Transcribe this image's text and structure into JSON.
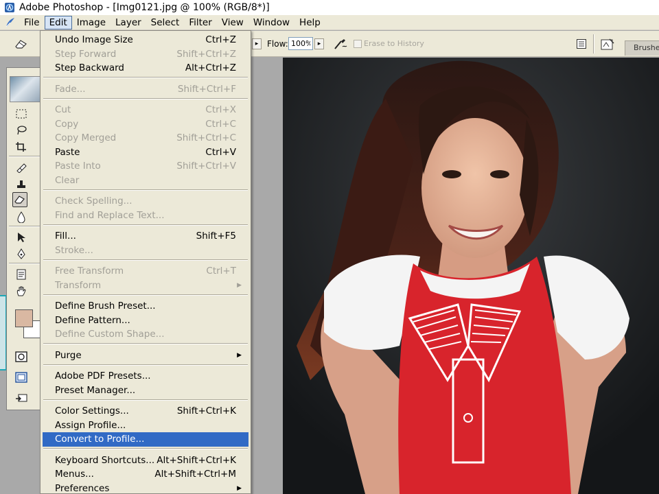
{
  "window": {
    "title": "Adobe Photoshop - [Img0121.jpg @ 100% (RGB/8*)]"
  },
  "menubar": {
    "items": [
      "File",
      "Edit",
      "Image",
      "Layer",
      "Select",
      "Filter",
      "View",
      "Window",
      "Help"
    ],
    "active": "Edit"
  },
  "options": {
    "flow_label": "Flow:",
    "flow_value": "100%",
    "erase_history_label": "Erase to History",
    "brushes_tab": "Brushes"
  },
  "edit_menu": {
    "items": [
      {
        "label": "Undo Image Size",
        "shortcut": "Ctrl+Z",
        "enabled": true
      },
      {
        "label": "Step Forward",
        "shortcut": "Shift+Ctrl+Z",
        "enabled": false
      },
      {
        "label": "Step Backward",
        "shortcut": "Alt+Ctrl+Z",
        "enabled": true
      },
      {
        "label": "Fade...",
        "shortcut": "Shift+Ctrl+F",
        "enabled": false
      },
      {
        "label": "Cut",
        "shortcut": "Ctrl+X",
        "enabled": false
      },
      {
        "label": "Copy",
        "shortcut": "Ctrl+C",
        "enabled": false
      },
      {
        "label": "Copy Merged",
        "shortcut": "Shift+Ctrl+C",
        "enabled": false
      },
      {
        "label": "Paste",
        "shortcut": "Ctrl+V",
        "enabled": true
      },
      {
        "label": "Paste Into",
        "shortcut": "Shift+Ctrl+V",
        "enabled": false
      },
      {
        "label": "Clear",
        "shortcut": "",
        "enabled": false
      },
      {
        "label": "Check Spelling...",
        "shortcut": "",
        "enabled": false
      },
      {
        "label": "Find and Replace Text...",
        "shortcut": "",
        "enabled": false
      },
      {
        "label": "Fill...",
        "shortcut": "Shift+F5",
        "enabled": true
      },
      {
        "label": "Stroke...",
        "shortcut": "",
        "enabled": false
      },
      {
        "label": "Free Transform",
        "shortcut": "Ctrl+T",
        "enabled": false
      },
      {
        "label": "Transform",
        "shortcut": "",
        "enabled": false,
        "submenu": true
      },
      {
        "label": "Define Brush Preset...",
        "shortcut": "",
        "enabled": true
      },
      {
        "label": "Define Pattern...",
        "shortcut": "",
        "enabled": true
      },
      {
        "label": "Define Custom Shape...",
        "shortcut": "",
        "enabled": false
      },
      {
        "label": "Purge",
        "shortcut": "",
        "enabled": true,
        "submenu": true
      },
      {
        "label": "Adobe PDF Presets...",
        "shortcut": "",
        "enabled": true
      },
      {
        "label": "Preset Manager...",
        "shortcut": "",
        "enabled": true
      },
      {
        "label": "Color Settings...",
        "shortcut": "Shift+Ctrl+K",
        "enabled": true
      },
      {
        "label": "Assign Profile...",
        "shortcut": "",
        "enabled": true
      },
      {
        "label": "Convert to Profile...",
        "shortcut": "",
        "enabled": true,
        "highlighted": true
      },
      {
        "label": "Keyboard Shortcuts...",
        "shortcut": "Alt+Shift+Ctrl+K",
        "enabled": true
      },
      {
        "label": "Menus...",
        "shortcut": "Alt+Shift+Ctrl+M",
        "enabled": true
      },
      {
        "label": "Preferences",
        "shortcut": "",
        "enabled": true,
        "submenu": true
      }
    ]
  },
  "toolbox": {
    "foreground_color": "#d9b8a2",
    "background_color": "#ffffff"
  },
  "colors": {
    "menu_bg": "#ece9d8",
    "highlight": "#316ac5",
    "disabled_text": "#a19f97"
  }
}
